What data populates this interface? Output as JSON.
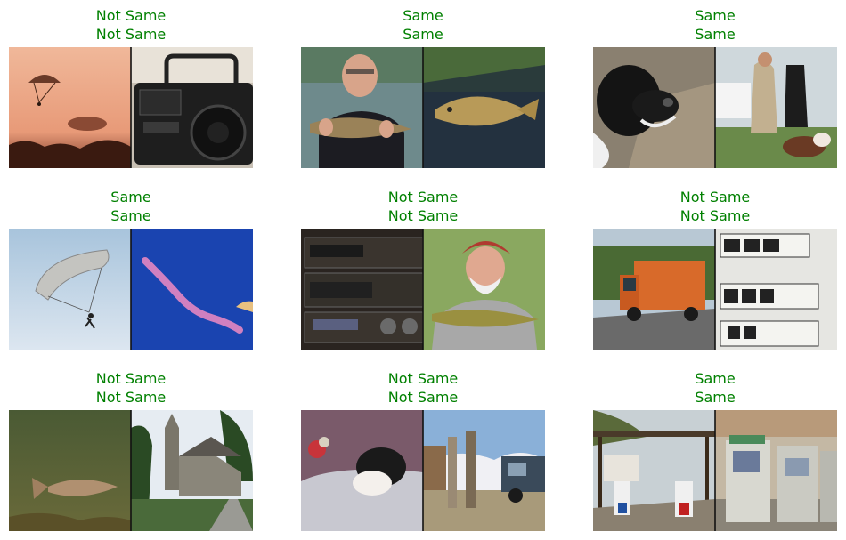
{
  "panels": [
    {
      "line1": "Not Same",
      "line2": "Not Same",
      "left_subject": "parachutes-sunset",
      "right_subject": "boombox"
    },
    {
      "line1": "Same",
      "line2": "Same",
      "left_subject": "man-holding-fish",
      "right_subject": "fish-in-net"
    },
    {
      "line1": "Same",
      "line2": "Same",
      "left_subject": "spaniel-dog",
      "right_subject": "dog-show"
    },
    {
      "line1": "Same",
      "line2": "Same",
      "left_subject": "parachute-sky",
      "right_subject": "parachute-smoke-trail"
    },
    {
      "line1": "Not Same",
      "line2": "Not Same",
      "left_subject": "stereo-equipment",
      "right_subject": "man-with-fish"
    },
    {
      "line1": "Not Same",
      "line2": "Not Same",
      "left_subject": "garbage-truck",
      "right_subject": "gas-pump-meter"
    },
    {
      "line1": "Not Same",
      "line2": "Not Same",
      "left_subject": "fish-underwater",
      "right_subject": "church"
    },
    {
      "line1": "Not Same",
      "line2": "Not Same",
      "left_subject": "puppy-with-toy",
      "right_subject": "old-gas-pumps"
    },
    {
      "line1": "Same",
      "line2": "Same",
      "left_subject": "gas-station",
      "right_subject": "gas-pumps-closeup"
    }
  ],
  "colors": {
    "title": "#008000"
  }
}
